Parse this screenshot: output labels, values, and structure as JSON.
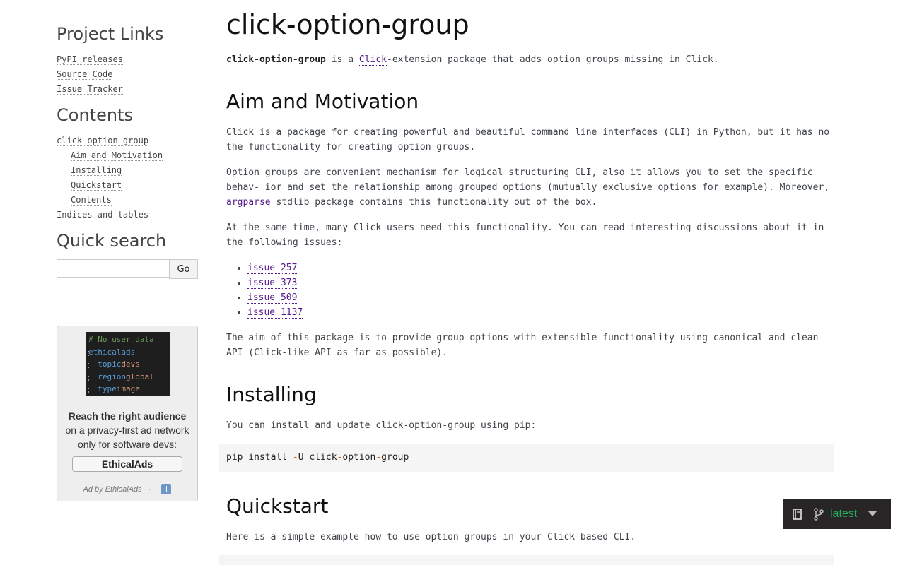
{
  "sidebar": {
    "project_links_title": "Project Links",
    "project_links": [
      "PyPI releases",
      "Source Code",
      "Issue Tracker"
    ],
    "contents_title": "Contents",
    "contents": [
      {
        "label": "click-option-group",
        "level": 1
      },
      {
        "label": "Aim and Motivation",
        "level": 2
      },
      {
        "label": "Installing",
        "level": 2
      },
      {
        "label": "Quickstart",
        "level": 2
      },
      {
        "label": "Contents",
        "level": 2
      },
      {
        "label": "Indices and tables",
        "level": 1
      }
    ],
    "search_title": "Quick search",
    "search_value": "",
    "search_button": "Go"
  },
  "ad": {
    "code_lines": [
      "# No user data",
      "ethicalads:",
      "  topic: devs",
      "  region: global",
      "  type: image"
    ],
    "headline": "Reach the right audience",
    "body": "on a privacy-first ad network only for software devs:",
    "cta": "EthicalAds",
    "footer": "Ad by EthicalAds",
    "footer_sep": "·",
    "info": "i"
  },
  "main": {
    "title": "click-option-group",
    "intro_bold": "click-option-group",
    "intro_1": " is a ",
    "intro_link": "Click",
    "intro_2": "-extension package that adds option groups missing in Click.",
    "aim_heading": "Aim and Motivation",
    "aim_p1": "Click is a package for creating powerful and beautiful command line interfaces (CLI) in Python, but it has no the functionality for creating option groups.",
    "aim_p2_a": "Option groups are convenient mechanism for logical structuring CLI, also it allows you to set the specific behav- ior and set the relationship among grouped options (mutually exclusive options for example). Moreover, ",
    "aim_p2_link": "argparse",
    "aim_p2_b": " stdlib package contains this functionality out of the box.",
    "aim_p3": "At the same time, many Click users need this functionality. You can read interesting discussions about it in the following issues:",
    "issues": [
      "issue 257",
      "issue 373",
      "issue 509",
      "issue 1137"
    ],
    "aim_p4": "The aim of this package is to provide group options with extensible functionality using canonical and clean API (Click-like API as far as possible).",
    "install_heading": "Installing",
    "install_p": "You can install and update click-option-group using pip:",
    "install_code": {
      "cmd": "pip install ",
      "flag": "-",
      "flag_rest": "U click",
      "dash1": "-",
      "mid": "option",
      "dash2": "-",
      "end": "group"
    },
    "quickstart_heading": "Quickstart",
    "quickstart_p": "Here is a simple example how to use option groups in your Click-based CLI."
  },
  "version_widget": {
    "version": "latest"
  }
}
